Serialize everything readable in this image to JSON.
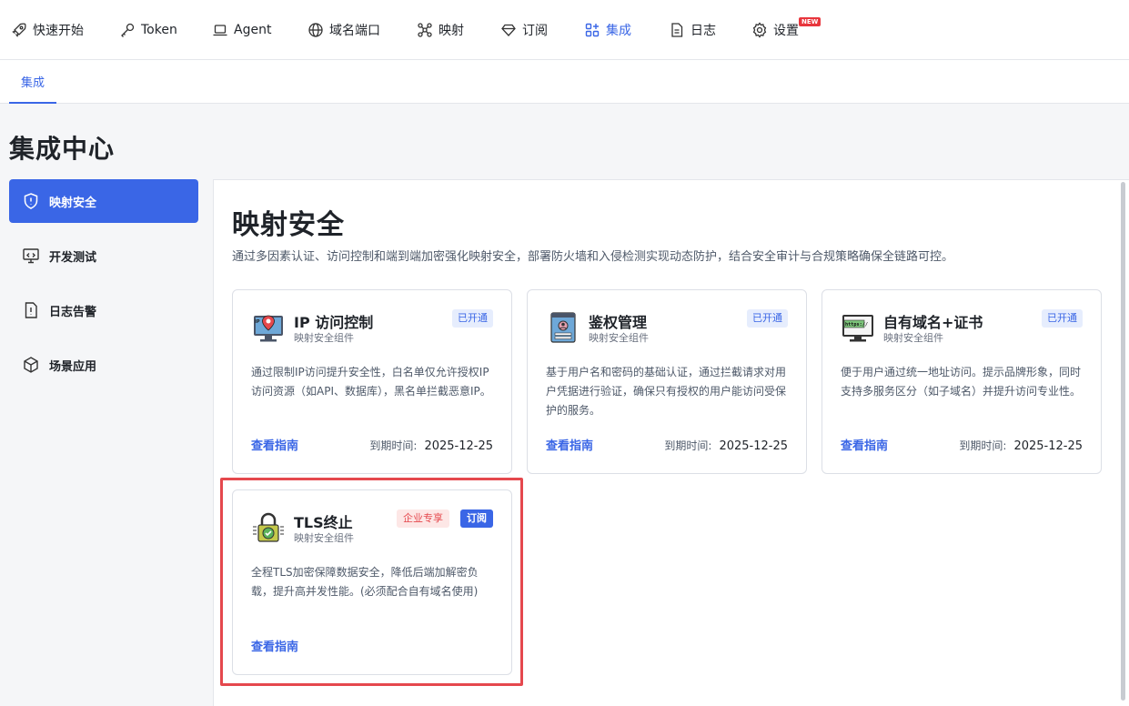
{
  "nav": {
    "items": [
      {
        "label": "快速开始",
        "icon": "rocket-icon"
      },
      {
        "label": "Token",
        "icon": "key-icon"
      },
      {
        "label": "Agent",
        "icon": "laptop-icon"
      },
      {
        "label": "域名端口",
        "icon": "globe-icon"
      },
      {
        "label": "映射",
        "icon": "network-icon"
      },
      {
        "label": "订阅",
        "icon": "diamond-icon"
      },
      {
        "label": "集成",
        "icon": "apps-icon",
        "active": true
      },
      {
        "label": "日志",
        "icon": "document-icon"
      },
      {
        "label": "设置",
        "icon": "gear-icon",
        "badge": "NEW"
      }
    ]
  },
  "subtabs": [
    {
      "label": "集成",
      "active": true
    }
  ],
  "page": {
    "title": "集成中心"
  },
  "sidebar": {
    "items": [
      {
        "label": "映射安全",
        "icon": "shield-icon",
        "active": true
      },
      {
        "label": "开发测试",
        "icon": "monitor-code-icon"
      },
      {
        "label": "日志告警",
        "icon": "alert-doc-icon"
      },
      {
        "label": "场景应用",
        "icon": "cube-icon"
      }
    ]
  },
  "section": {
    "title": "映射安全",
    "description": "通过多因素认证、访问控制和端到端加密强化映射安全，部署防火墙和入侵检测实现动态防护，结合安全审计与合规策略确保全链路可控。"
  },
  "cards": [
    {
      "title": "IP 访问控制",
      "subtitle": "映射安全组件",
      "status": "已开通",
      "description": "通过限制IP访问提升安全性，白名单仅允许授权IP访问资源（如API、数据库），黑名单拦截恶意IP。",
      "link": "查看指南",
      "expiry_label": "到期时间:",
      "expiry_date": "2025-12-25",
      "icon": "ip-monitor-icon"
    },
    {
      "title": "鉴权管理",
      "subtitle": "映射安全组件",
      "status": "已开通",
      "description": "基于用户名和密码的基础认证，通过拦截请求对用户凭据进行验证，确保只有授权的用户能访问受保护的服务。",
      "link": "查看指南",
      "expiry_label": "到期时间:",
      "expiry_date": "2025-12-25",
      "icon": "auth-card-icon"
    },
    {
      "title": "自有域名+证书",
      "subtitle": "映射安全组件",
      "status": "已开通",
      "description": "便于用户通过统一地址访问。提示品牌形象，同时支持多服务区分（如子域名）并提升访问专业性。",
      "link": "查看指南",
      "expiry_label": "到期时间:",
      "expiry_date": "2025-12-25",
      "icon": "https-monitor-icon",
      "icon_text": "https://"
    },
    {
      "title": "TLS终止",
      "subtitle": "映射安全组件",
      "enterprise_badge": "企业专享",
      "subscribe_label": "订阅",
      "description": "全程TLS加密保障数据安全，降低后端加解密负载，提升高并发性能。(必须配合自有域名使用)",
      "link": "查看指南",
      "icon": "tls-lock-icon"
    }
  ],
  "colors": {
    "accent": "#3a66e6",
    "highlight": "#e5484d",
    "enterprise": "#e5484d"
  }
}
